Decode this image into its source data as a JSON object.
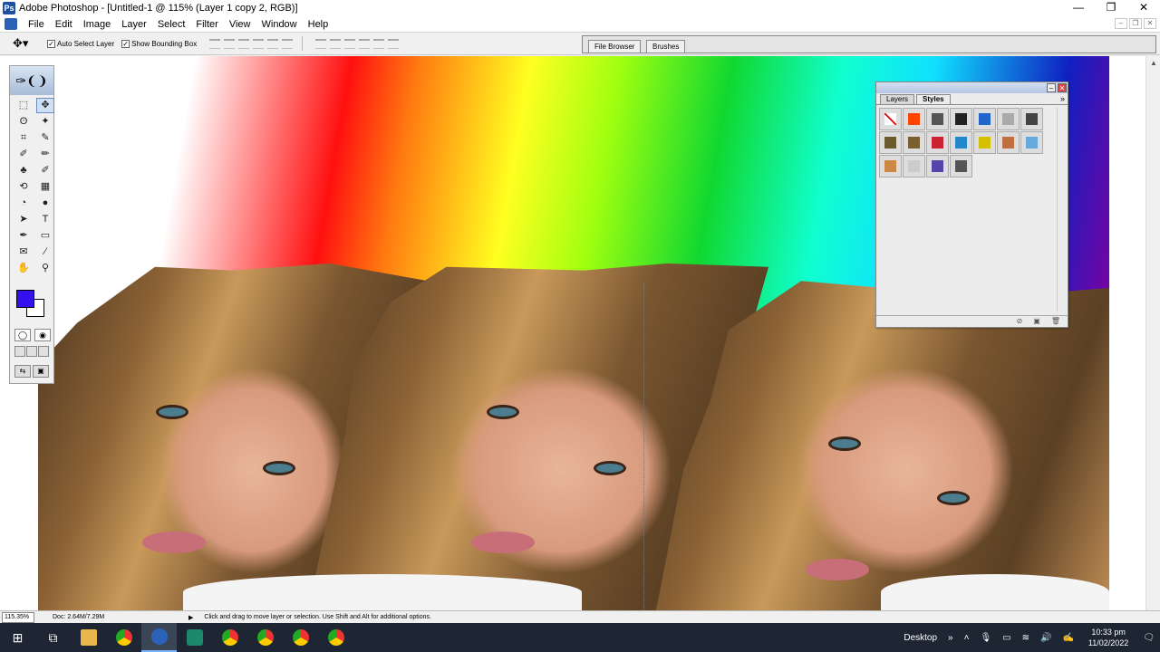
{
  "window": {
    "title": "Adobe Photoshop - [Untitled-1 @ 115% (Layer 1 copy 2, RGB)]",
    "controls": [
      "—",
      "❐",
      "✕"
    ]
  },
  "menubar": {
    "items": [
      "File",
      "Edit",
      "Image",
      "Layer",
      "Select",
      "Filter",
      "View",
      "Window",
      "Help"
    ]
  },
  "options": {
    "auto_select_label": "Auto Select Layer",
    "bounding_box_label": "Show Bounding Box",
    "well_tabs": [
      "File Browser",
      "Brushes"
    ]
  },
  "toolbox": {
    "tools": [
      "⬚",
      "✥",
      "ʘ",
      "✦",
      "⌗",
      "✎",
      "✐",
      "✏",
      "♣",
      "✐",
      "⟲",
      "▦",
      "◔",
      "●",
      "➤",
      "T",
      "✒",
      "▭",
      "✉",
      "⁄",
      "✋",
      "⚲"
    ],
    "foreground_color": "#3311ee",
    "background_color": "#ffffff"
  },
  "styles_panel": {
    "tabs": [
      "Layers",
      "Styles"
    ],
    "active_tab": "Styles",
    "swatch_colors": [
      "#ffffff",
      "#ff4400",
      "#555555",
      "#222222",
      "#2266cc",
      "#aaaaaa",
      "#444444",
      "#6b5a2e",
      "#7a6030",
      "#cc2233",
      "#2288cc",
      "#d4c000",
      "#c07040",
      "#66aadd",
      "#cc8844",
      "#cccccc",
      "#5544aa",
      "#555555"
    ]
  },
  "status": {
    "zoom": "115.35%",
    "doc": "Doc: 2.64M/7.29M",
    "hint": "Click and drag to move layer or selection. Use Shift and Alt for additional options."
  },
  "taskbar": {
    "desktop_label": "Desktop",
    "time": "10:33 pm",
    "date": "11/02/2022"
  }
}
